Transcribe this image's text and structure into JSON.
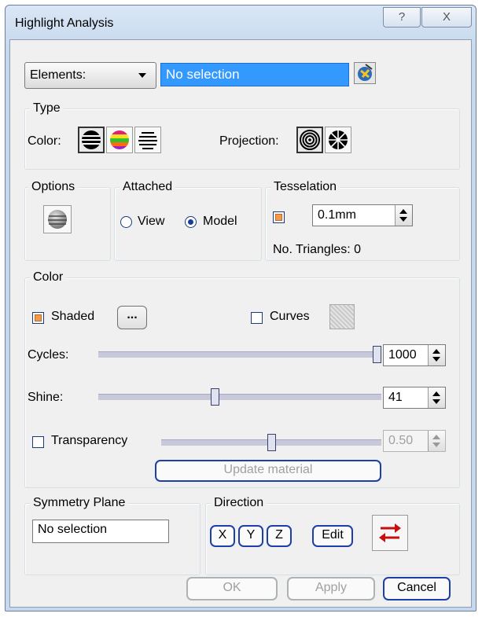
{
  "window": {
    "title": "Highlight Analysis",
    "help_symbol": "?",
    "close_symbol": "X"
  },
  "elements": {
    "dropdown_label": "Elements:",
    "field_value": "No selection"
  },
  "type": {
    "legend": "Type",
    "color_label": "Color:",
    "projection_label": "Projection:"
  },
  "options": {
    "legend": "Options"
  },
  "attached": {
    "legend": "Attached",
    "view_label": "View",
    "model_label": "Model",
    "selected": "Model"
  },
  "tesselation": {
    "legend": "Tesselation",
    "value": "0.1mm",
    "triangles_text": "No. Triangles: 0"
  },
  "color": {
    "legend": "Color",
    "shaded_label": "Shaded",
    "shaded_checked": true,
    "more_button": "...",
    "curves_label": "Curves",
    "curves_checked": false,
    "cycles": {
      "label": "Cycles:",
      "value": "1000",
      "fraction": 1.0
    },
    "shine": {
      "label": "Shine:",
      "value": "41",
      "fraction": 0.41
    },
    "transparency": {
      "label": "Transparency",
      "value": "0.50",
      "fraction": 0.5,
      "checked": false
    },
    "update_button": "Update material"
  },
  "symmetry": {
    "legend": "Symmetry Plane",
    "value": "No selection"
  },
  "direction": {
    "legend": "Direction",
    "x": "X",
    "y": "Y",
    "z": "Z",
    "edit": "Edit"
  },
  "footer": {
    "ok": "OK",
    "apply": "Apply",
    "cancel": "Cancel"
  },
  "colors": {
    "accent_blue": "#3399ff",
    "orange": "#f09a4d",
    "reverse_red": "#c41010"
  }
}
